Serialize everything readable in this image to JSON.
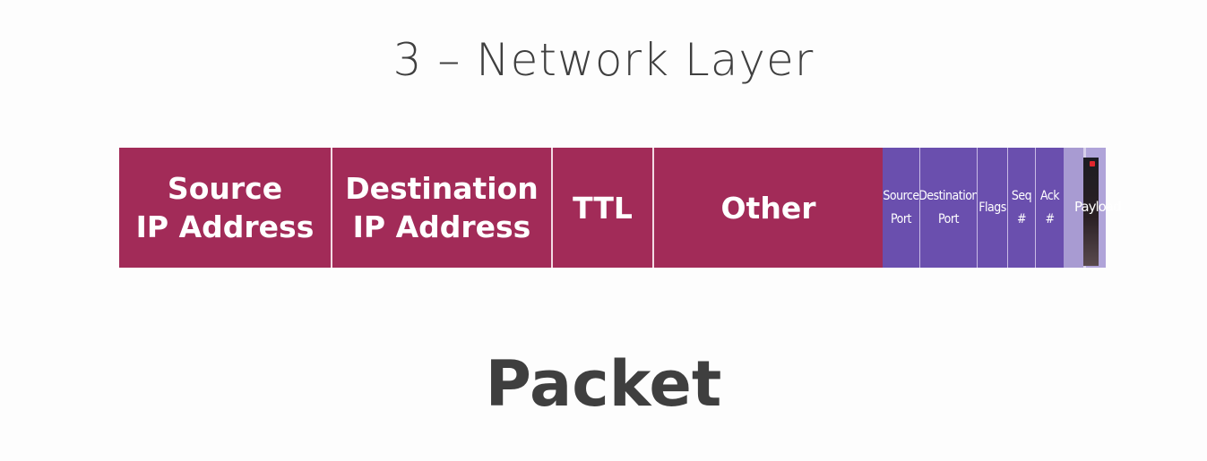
{
  "title": "3 – Network Layer",
  "subtitle": "Packet",
  "ip_header": [
    {
      "line1": "Source",
      "line2": "IP Address"
    },
    {
      "line1": "Destination",
      "line2": "IP Address"
    },
    {
      "line1": "TTL",
      "line2": ""
    },
    {
      "line1": "Other",
      "line2": ""
    }
  ],
  "tcp_header": [
    {
      "line1": "Source",
      "line2": "Port"
    },
    {
      "line1": "Destination",
      "line2": "Port"
    },
    {
      "line1": "Flags",
      "line2": ""
    },
    {
      "line1": "Seq",
      "line2": "#"
    },
    {
      "line1": "Ack",
      "line2": "#"
    }
  ],
  "payload_label": "Payload",
  "colors": {
    "ip_block": "#a22b58",
    "tcp_block": "#6a4fae",
    "payload_block": "#a89bd2",
    "text_dark": "#3f3f3f"
  }
}
